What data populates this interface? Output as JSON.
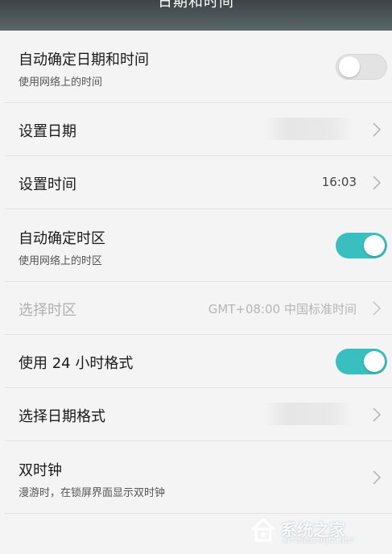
{
  "header": {
    "title": "日期和时间"
  },
  "rows": [
    {
      "label": "自动确定日期和时间",
      "sublabel": "使用网络上的时间",
      "toggle": "off"
    },
    {
      "label": "设置日期",
      "value": ""
    },
    {
      "label": "设置时间",
      "value": "16:03"
    },
    {
      "label": "自动确定时区",
      "sublabel": "使用网络上的时区",
      "toggle": "on"
    },
    {
      "label": "选择时区",
      "value": "GMT+08:00 中国标准时间",
      "disabled": true
    },
    {
      "label": "使用 24 小时格式",
      "toggle": "on"
    },
    {
      "label": "选择日期格式",
      "value": ""
    },
    {
      "label": "双时钟",
      "sublabel": "漫游时，在锁屏界面显示双时钟"
    }
  ],
  "watermark": {
    "text": "系统之家",
    "url": "XITONGZHIJIA.NET"
  },
  "colors": {
    "accent": "#39bfbf",
    "header_bg": "#4a5456",
    "page_bg": "#f4f4f4"
  },
  "icons": {
    "chevron": "chevron-right-icon",
    "logo": "system-home-logo-icon"
  }
}
